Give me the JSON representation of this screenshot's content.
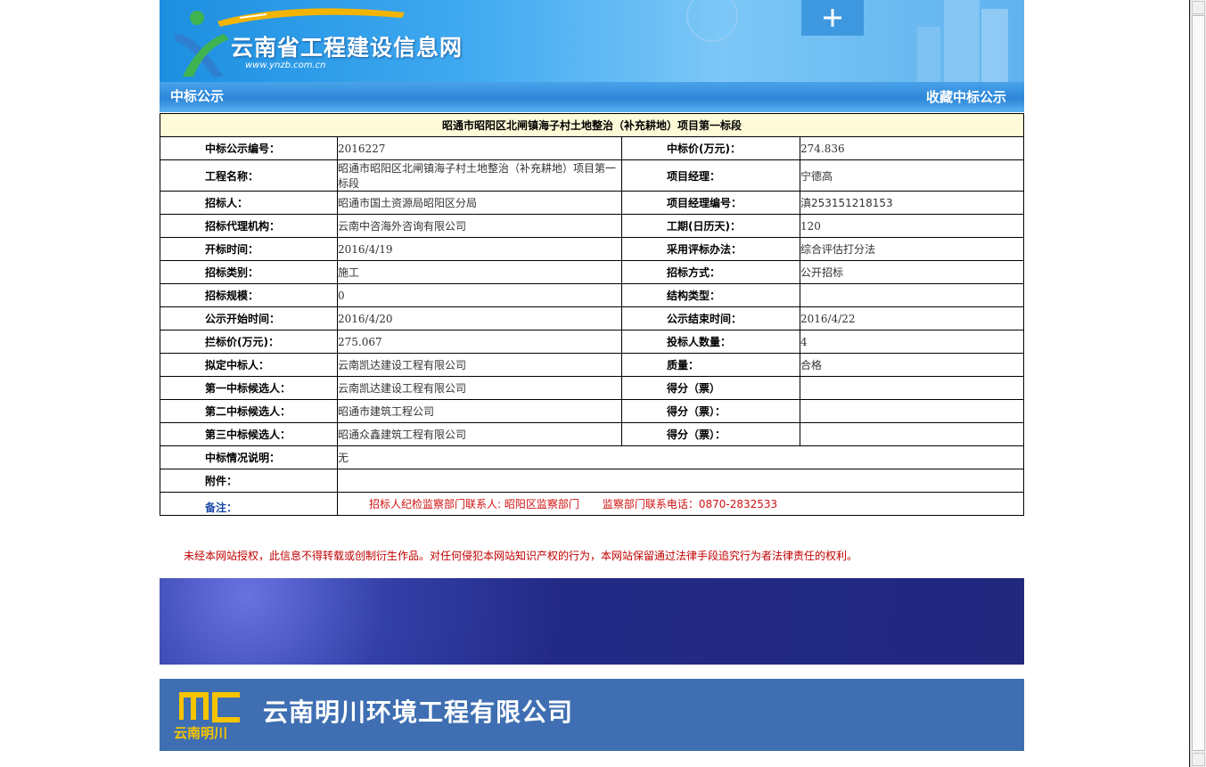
{
  "header": {
    "site_title": "云南省工程建设信息网",
    "site_url": "www.ynzb.com.cn",
    "section_title": "中标公示",
    "favorite_link": "收藏中标公示"
  },
  "notice": {
    "title": "昭通市昭阳区北闸镇海子村土地整治（补充耕地）项目第一标段",
    "rows": [
      {
        "l1": "中标公示编号：",
        "v1": "2016227",
        "l2": "中标价(万元)：",
        "v2": "274.836"
      },
      {
        "l1": "工程名称：",
        "v1": "昭通市昭阳区北闸镇海子村土地整治（补充耕地）项目第一标段",
        "l2": "项目经理：",
        "v2": "宁德高"
      },
      {
        "l1": "招标人：",
        "v1": "昭通市国土资源局昭阳区分局",
        "l2": "项目经理编号：",
        "v2": "滇253151218153"
      },
      {
        "l1": "招标代理机构：",
        "v1": "云南中咨海外咨询有限公司",
        "l2": "工期(日历天)：",
        "v2": "120"
      },
      {
        "l1": "开标时间：",
        "v1": "2016/4/19",
        "l2": "采用评标办法：",
        "v2": "综合评估打分法"
      },
      {
        "l1": "招标类别：",
        "v1": "施工",
        "l2": "招标方式：",
        "v2": "公开招标"
      },
      {
        "l1": "招标规模：",
        "v1": "0",
        "l2": "结构类型：",
        "v2": ""
      },
      {
        "l1": "公示开始时间：",
        "v1": "2016/4/20",
        "l2": "公示结束时间：",
        "v2": "2016/4/22"
      },
      {
        "l1": "拦标价(万元)：",
        "v1": "275.067",
        "l2": "投标人数量：",
        "v2": "4"
      },
      {
        "l1": "拟定中标人：",
        "v1": "云南凯达建设工程有限公司",
        "l2": "质量：",
        "v2": "合格"
      },
      {
        "l1": "第一中标候选人：",
        "v1": "云南凯达建设工程有限公司",
        "l2": "得分（票）",
        "v2": ""
      },
      {
        "l1": "第二中标候选人：",
        "v1": "昭通市建筑工程公司",
        "l2": "得分（票）：",
        "v2": ""
      },
      {
        "l1": "第三中标候选人：",
        "v1": "昭通众鑫建筑工程有限公司",
        "l2": "得分（票）：",
        "v2": ""
      }
    ],
    "desc_label": "中标情况说明：",
    "desc_value": "无",
    "attach_label": "附件：",
    "attach_value": "",
    "remark_label": "备注：",
    "remark_contact": "招标人纪检监察部门联系人: 昭阳区监察部门",
    "remark_phone": "监察部门联系电话：0870-2832533"
  },
  "copyright": "未经本网站授权，此信息不得转载或创制衍生作品。对任何侵犯本网站知识产权的行为，本网站保留通过法律手段追究行为者法律责任的权利。",
  "ad2": {
    "logo_sub": "云南明川",
    "company": "云南明川环境工程有限公司"
  },
  "colors": {
    "title_bg": "#fffbd8",
    "accent_blue": "#2d86d8",
    "warning_red": "#c00000",
    "ad_blue": "#3f6fb2",
    "ad_navy": "#232a86"
  }
}
